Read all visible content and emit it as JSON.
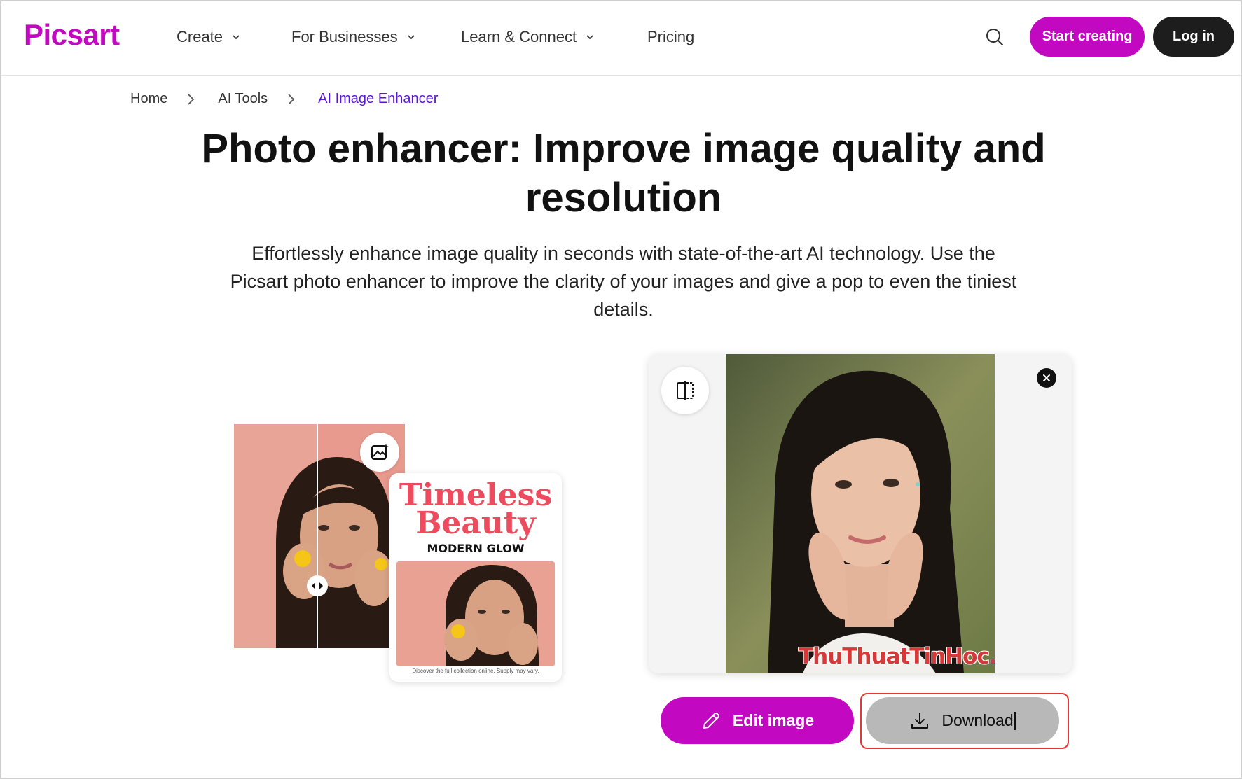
{
  "header": {
    "logo": "Picsart",
    "nav": [
      {
        "label": "Create",
        "has_dropdown": true
      },
      {
        "label": "For Businesses",
        "has_dropdown": true
      },
      {
        "label": "Learn & Connect",
        "has_dropdown": true
      },
      {
        "label": "Pricing",
        "has_dropdown": false
      }
    ],
    "search_icon": "search-icon",
    "start_label": "Start creating",
    "login_label": "Log in"
  },
  "breadcrumb": {
    "items": [
      "Home",
      "AI Tools",
      "AI Image Enhancer"
    ]
  },
  "hero": {
    "title_line1": "Photo enhancer: Improve image quality and",
    "title_line2": "resolution",
    "subtitle_line1": "Effortlessly enhance image quality in seconds with state-of-the-art AI technology. Use the",
    "subtitle_line2": "Picsart photo enhancer to improve the clarity of your images and give a pop to even the tiniest",
    "subtitle_line3": "details."
  },
  "illustration": {
    "card_title_line1": "Timeless",
    "card_title_line2": "Beauty",
    "card_subtitle": "MODERN GLOW",
    "card_footer": "Discover the full collection online. Supply may vary."
  },
  "preview": {
    "watermark": "ThuThuatTinHoc.vn"
  },
  "actions": {
    "edit_label": "Edit image",
    "download_label": "Download"
  },
  "colors": {
    "brand": "#c209c1",
    "breadcrumb_active": "#5a15d8",
    "highlight": "#e53935"
  }
}
